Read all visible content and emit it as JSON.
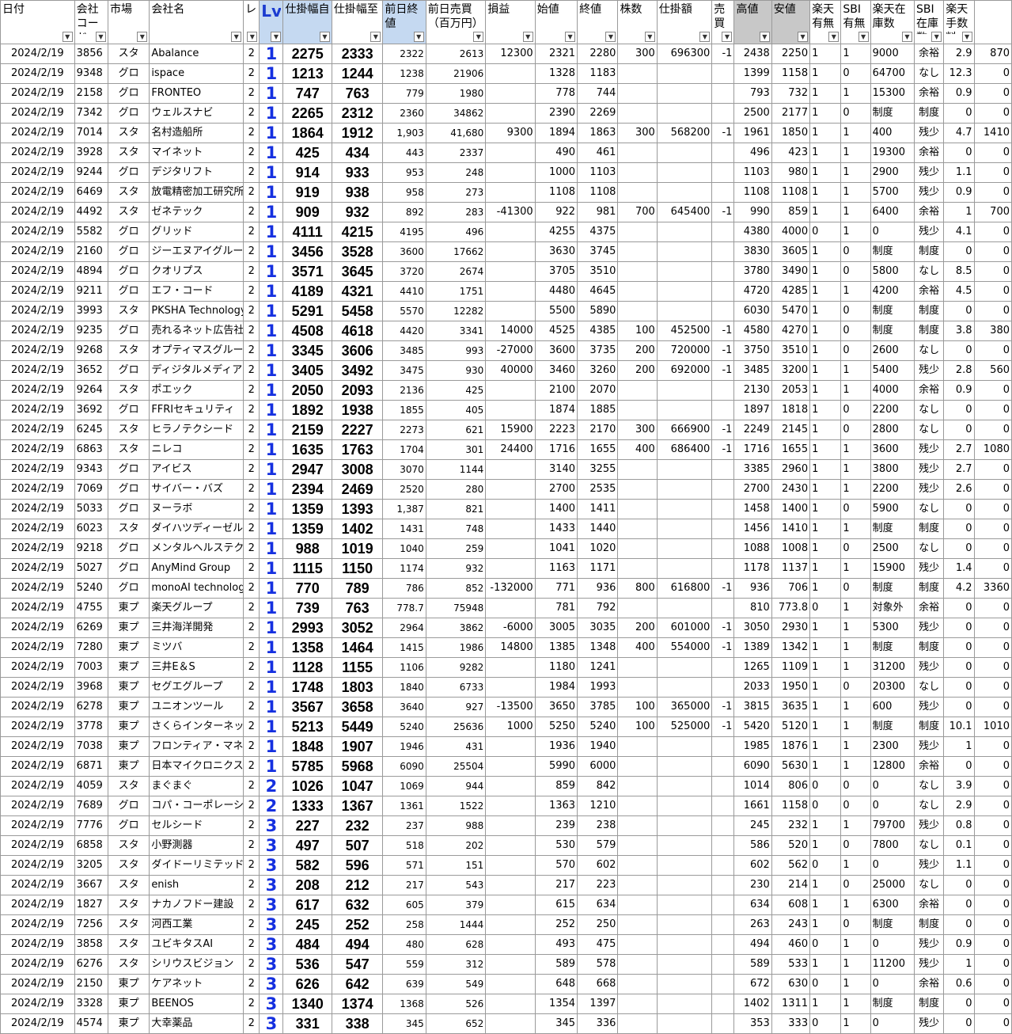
{
  "headers": [
    {
      "label": "日付",
      "style": ""
    },
    {
      "label": "会社コード",
      "style": ""
    },
    {
      "label": "市場",
      "style": ""
    },
    {
      "label": "会社名",
      "style": ""
    },
    {
      "label": "レ",
      "style": ""
    },
    {
      "label": "Lv",
      "style": "lv"
    },
    {
      "label": "仕掛幅自",
      "style": "blue"
    },
    {
      "label": "仕掛幅至",
      "style": ""
    },
    {
      "label": "前日終値",
      "style": "blue"
    },
    {
      "label": "前日売買（百万円）",
      "style": ""
    },
    {
      "label": "損益",
      "style": ""
    },
    {
      "label": "始値",
      "style": ""
    },
    {
      "label": "終値",
      "style": ""
    },
    {
      "label": "株数",
      "style": ""
    },
    {
      "label": "仕掛額",
      "style": ""
    },
    {
      "label": "売買",
      "style": ""
    },
    {
      "label": "高値",
      "style": "gray"
    },
    {
      "label": "安値",
      "style": "gray"
    },
    {
      "label": "楽天有無",
      "style": ""
    },
    {
      "label": "SBI有無",
      "style": ""
    },
    {
      "label": "楽天在庫数",
      "style": ""
    },
    {
      "label": "SBI在庫数",
      "style": ""
    },
    {
      "label": "楽天手数料",
      "style": ""
    },
    {
      "label": "",
      "style": ""
    }
  ],
  "rows": [
    [
      "2024/2/19",
      "3856",
      "スタ",
      "Abalance",
      "2",
      "1",
      "2275",
      "2333",
      "2322",
      "2613",
      "12300",
      "2321",
      "2280",
      "300",
      "696300",
      "-1",
      "2438",
      "2250",
      "1",
      "1",
      "9000",
      "余裕",
      "2.9",
      "870"
    ],
    [
      "2024/2/19",
      "9348",
      "グロ",
      "ispace",
      "2",
      "1",
      "1213",
      "1244",
      "1238",
      "21906",
      "",
      "1328",
      "1183",
      "",
      "",
      "",
      "1399",
      "1158",
      "1",
      "0",
      "64700",
      "なし",
      "12.3",
      "0"
    ],
    [
      "2024/2/19",
      "2158",
      "グロ",
      "FRONTEO",
      "2",
      "1",
      "747",
      "763",
      "779",
      "1980",
      "",
      "778",
      "744",
      "",
      "",
      "",
      "793",
      "732",
      "1",
      "1",
      "15300",
      "余裕",
      "0.9",
      "0"
    ],
    [
      "2024/2/19",
      "7342",
      "グロ",
      "ウェルスナビ",
      "2",
      "1",
      "2265",
      "2312",
      "2360",
      "34862",
      "",
      "2390",
      "2269",
      "",
      "",
      "",
      "2500",
      "2177",
      "1",
      "0",
      "制度",
      "制度",
      "0",
      "0"
    ],
    [
      "2024/2/19",
      "7014",
      "スタ",
      "名村造船所",
      "2",
      "1",
      "1864",
      "1912",
      "1,903",
      "41,680",
      "9300",
      "1894",
      "1863",
      "300",
      "568200",
      "-1",
      "1961",
      "1850",
      "1",
      "1",
      "400",
      "残少",
      "4.7",
      "1410"
    ],
    [
      "2024/2/19",
      "3928",
      "スタ",
      "マイネット",
      "2",
      "1",
      "425",
      "434",
      "443",
      "2337",
      "",
      "490",
      "461",
      "",
      "",
      "",
      "496",
      "423",
      "1",
      "1",
      "19300",
      "余裕",
      "0",
      "0"
    ],
    [
      "2024/2/19",
      "9244",
      "グロ",
      "デジタリフト",
      "2",
      "1",
      "914",
      "933",
      "953",
      "248",
      "",
      "1000",
      "1103",
      "",
      "",
      "",
      "1103",
      "980",
      "1",
      "1",
      "2900",
      "残少",
      "1.1",
      "0"
    ],
    [
      "2024/2/19",
      "6469",
      "スタ",
      "放電精密加工研究所",
      "2",
      "1",
      "919",
      "938",
      "958",
      "273",
      "",
      "1108",
      "1108",
      "",
      "",
      "",
      "1108",
      "1108",
      "1",
      "1",
      "5700",
      "残少",
      "0.9",
      "0"
    ],
    [
      "2024/2/19",
      "4492",
      "スタ",
      "ゼネテック",
      "2",
      "1",
      "909",
      "932",
      "892",
      "283",
      "-41300",
      "922",
      "981",
      "700",
      "645400",
      "-1",
      "990",
      "859",
      "1",
      "1",
      "6400",
      "余裕",
      "1",
      "700"
    ],
    [
      "2024/2/19",
      "5582",
      "グロ",
      "グリッド",
      "2",
      "1",
      "4111",
      "4215",
      "4195",
      "496",
      "",
      "4255",
      "4375",
      "",
      "",
      "",
      "4380",
      "4000",
      "0",
      "1",
      "0",
      "残少",
      "4.1",
      "0"
    ],
    [
      "2024/2/19",
      "2160",
      "グロ",
      "ジーエヌアイグループ",
      "2",
      "1",
      "3456",
      "3528",
      "3600",
      "17662",
      "",
      "3630",
      "3745",
      "",
      "",
      "",
      "3830",
      "3605",
      "1",
      "0",
      "制度",
      "制度",
      "0",
      "0"
    ],
    [
      "2024/2/19",
      "4894",
      "グロ",
      "クオリプス",
      "2",
      "1",
      "3571",
      "3645",
      "3720",
      "2674",
      "",
      "3705",
      "3510",
      "",
      "",
      "",
      "3780",
      "3490",
      "1",
      "0",
      "5800",
      "なし",
      "8.5",
      "0"
    ],
    [
      "2024/2/19",
      "9211",
      "グロ",
      "エフ・コード",
      "2",
      "1",
      "4189",
      "4321",
      "4410",
      "1751",
      "",
      "4480",
      "4645",
      "",
      "",
      "",
      "4720",
      "4285",
      "1",
      "1",
      "4200",
      "余裕",
      "4.5",
      "0"
    ],
    [
      "2024/2/19",
      "3993",
      "スタ",
      "PKSHA Technology",
      "2",
      "1",
      "5291",
      "5458",
      "5570",
      "12282",
      "",
      "5500",
      "5890",
      "",
      "",
      "",
      "6030",
      "5470",
      "1",
      "0",
      "制度",
      "制度",
      "0",
      "0"
    ],
    [
      "2024/2/19",
      "9235",
      "グロ",
      "売れるネット広告社",
      "2",
      "1",
      "4508",
      "4618",
      "4420",
      "3341",
      "14000",
      "4525",
      "4385",
      "100",
      "452500",
      "-1",
      "4580",
      "4270",
      "1",
      "0",
      "制度",
      "制度",
      "3.8",
      "380"
    ],
    [
      "2024/2/19",
      "9268",
      "スタ",
      "オプティマスグループ",
      "2",
      "1",
      "3345",
      "3606",
      "3485",
      "993",
      "-27000",
      "3600",
      "3735",
      "200",
      "720000",
      "-1",
      "3750",
      "3510",
      "1",
      "0",
      "2600",
      "なし",
      "0",
      "0"
    ],
    [
      "2024/2/19",
      "3652",
      "グロ",
      "ディジタルメディアプロフェッショナル",
      "2",
      "1",
      "3405",
      "3492",
      "3475",
      "930",
      "40000",
      "3460",
      "3260",
      "200",
      "692000",
      "-1",
      "3485",
      "3200",
      "1",
      "1",
      "5400",
      "残少",
      "2.8",
      "560"
    ],
    [
      "2024/2/19",
      "9264",
      "スタ",
      "ポエック",
      "2",
      "1",
      "2050",
      "2093",
      "2136",
      "425",
      "",
      "2100",
      "2070",
      "",
      "",
      "",
      "2130",
      "2053",
      "1",
      "1",
      "4000",
      "余裕",
      "0.9",
      "0"
    ],
    [
      "2024/2/19",
      "3692",
      "グロ",
      "FFRIセキュリティ",
      "2",
      "1",
      "1892",
      "1938",
      "1855",
      "405",
      "",
      "1874",
      "1885",
      "",
      "",
      "",
      "1897",
      "1818",
      "1",
      "0",
      "2200",
      "なし",
      "0",
      "0"
    ],
    [
      "2024/2/19",
      "6245",
      "スタ",
      "ヒラノテクシード",
      "2",
      "1",
      "2159",
      "2227",
      "2273",
      "621",
      "15900",
      "2223",
      "2170",
      "300",
      "666900",
      "-1",
      "2249",
      "2145",
      "1",
      "0",
      "2800",
      "なし",
      "0",
      "0"
    ],
    [
      "2024/2/19",
      "6863",
      "スタ",
      "ニレコ",
      "2",
      "1",
      "1635",
      "1763",
      "1704",
      "301",
      "24400",
      "1716",
      "1655",
      "400",
      "686400",
      "-1",
      "1716",
      "1655",
      "1",
      "1",
      "3600",
      "残少",
      "2.7",
      "1080"
    ],
    [
      "2024/2/19",
      "9343",
      "グロ",
      "アイビス",
      "2",
      "1",
      "2947",
      "3008",
      "3070",
      "1144",
      "",
      "3140",
      "3255",
      "",
      "",
      "",
      "3385",
      "2960",
      "1",
      "1",
      "3800",
      "残少",
      "2.7",
      "0"
    ],
    [
      "2024/2/19",
      "7069",
      "グロ",
      "サイバー・バズ",
      "2",
      "1",
      "2394",
      "2469",
      "2520",
      "280",
      "",
      "2700",
      "2535",
      "",
      "",
      "",
      "2700",
      "2430",
      "1",
      "1",
      "2200",
      "残少",
      "2.6",
      "0"
    ],
    [
      "2024/2/19",
      "5033",
      "グロ",
      "ヌーラボ",
      "2",
      "1",
      "1359",
      "1393",
      "1,387",
      "821",
      "",
      "1400",
      "1411",
      "",
      "",
      "",
      "1458",
      "1400",
      "1",
      "0",
      "5900",
      "なし",
      "0",
      "0"
    ],
    [
      "2024/2/19",
      "6023",
      "スタ",
      "ダイハツディーゼル",
      "2",
      "1",
      "1359",
      "1402",
      "1431",
      "748",
      "",
      "1433",
      "1440",
      "",
      "",
      "",
      "1456",
      "1410",
      "1",
      "1",
      "制度",
      "制度",
      "0",
      "0"
    ],
    [
      "2024/2/19",
      "9218",
      "グロ",
      "メンタルヘルステクノロジーズ",
      "2",
      "1",
      "988",
      "1019",
      "1040",
      "259",
      "",
      "1041",
      "1020",
      "",
      "",
      "",
      "1088",
      "1008",
      "1",
      "0",
      "2500",
      "なし",
      "0",
      "0"
    ],
    [
      "2024/2/19",
      "5027",
      "グロ",
      "AnyMind Group",
      "2",
      "1",
      "1115",
      "1150",
      "1174",
      "932",
      "",
      "1163",
      "1171",
      "",
      "",
      "",
      "1178",
      "1137",
      "1",
      "1",
      "15900",
      "残少",
      "1.4",
      "0"
    ],
    [
      "2024/2/19",
      "5240",
      "グロ",
      "monoAI technology",
      "2",
      "1",
      "770",
      "789",
      "786",
      "852",
      "-132000",
      "771",
      "936",
      "800",
      "616800",
      "-1",
      "936",
      "706",
      "1",
      "0",
      "制度",
      "制度",
      "4.2",
      "3360"
    ],
    [
      "2024/2/19",
      "4755",
      "東プ",
      "楽天グループ",
      "2",
      "1",
      "739",
      "763",
      "778.7",
      "75948",
      "",
      "781",
      "792",
      "",
      "",
      "",
      "810",
      "773.8",
      "0",
      "1",
      "対象外",
      "余裕",
      "0",
      "0"
    ],
    [
      "2024/2/19",
      "6269",
      "東プ",
      "三井海洋開発",
      "2",
      "1",
      "2993",
      "3052",
      "2964",
      "3862",
      "-6000",
      "3005",
      "3035",
      "200",
      "601000",
      "-1",
      "3050",
      "2930",
      "1",
      "1",
      "5300",
      "残少",
      "0",
      "0"
    ],
    [
      "2024/2/19",
      "7280",
      "東プ",
      "ミツバ",
      "2",
      "1",
      "1358",
      "1464",
      "1415",
      "1986",
      "14800",
      "1385",
      "1348",
      "400",
      "554000",
      "-1",
      "1389",
      "1342",
      "1",
      "1",
      "制度",
      "制度",
      "0",
      "0"
    ],
    [
      "2024/2/19",
      "7003",
      "東プ",
      "三井E＆S",
      "2",
      "1",
      "1128",
      "1155",
      "1106",
      "9282",
      "",
      "1180",
      "1241",
      "",
      "",
      "",
      "1265",
      "1109",
      "1",
      "1",
      "31200",
      "残少",
      "0",
      "0"
    ],
    [
      "2024/2/19",
      "3968",
      "東プ",
      "セグエグループ",
      "2",
      "1",
      "1748",
      "1803",
      "1840",
      "6733",
      "",
      "1984",
      "1993",
      "",
      "",
      "",
      "2033",
      "1950",
      "1",
      "0",
      "20300",
      "なし",
      "0",
      "0"
    ],
    [
      "2024/2/19",
      "6278",
      "東プ",
      "ユニオンツール",
      "2",
      "1",
      "3567",
      "3658",
      "3640",
      "927",
      "-13500",
      "3650",
      "3785",
      "100",
      "365000",
      "-1",
      "3815",
      "3635",
      "1",
      "1",
      "600",
      "残少",
      "0",
      "0"
    ],
    [
      "2024/2/19",
      "3778",
      "東プ",
      "さくらインターネット",
      "2",
      "1",
      "5213",
      "5449",
      "5240",
      "25636",
      "1000",
      "5250",
      "5240",
      "100",
      "525000",
      "-1",
      "5420",
      "5120",
      "1",
      "1",
      "制度",
      "制度",
      "10.1",
      "1010"
    ],
    [
      "2024/2/19",
      "7038",
      "東プ",
      "フロンティア・マネジメント",
      "2",
      "1",
      "1848",
      "1907",
      "1946",
      "431",
      "",
      "1936",
      "1940",
      "",
      "",
      "",
      "1985",
      "1876",
      "1",
      "1",
      "2300",
      "残少",
      "1",
      "0"
    ],
    [
      "2024/2/19",
      "6871",
      "東プ",
      "日本マイクロニクス",
      "2",
      "1",
      "5785",
      "5968",
      "6090",
      "25504",
      "",
      "5990",
      "6000",
      "",
      "",
      "",
      "6090",
      "5630",
      "1",
      "1",
      "12800",
      "余裕",
      "0",
      "0"
    ],
    [
      "2024/2/19",
      "4059",
      "スタ",
      "まぐまぐ",
      "2",
      "2",
      "1026",
      "1047",
      "1069",
      "944",
      "",
      "859",
      "842",
      "",
      "",
      "",
      "1014",
      "806",
      "0",
      "0",
      "0",
      "なし",
      "3.9",
      "0"
    ],
    [
      "2024/2/19",
      "7689",
      "グロ",
      "コパ・コーポレーション",
      "2",
      "2",
      "1333",
      "1367",
      "1361",
      "1522",
      "",
      "1363",
      "1210",
      "",
      "",
      "",
      "1661",
      "1158",
      "0",
      "0",
      "0",
      "なし",
      "2.9",
      "0"
    ],
    [
      "2024/2/19",
      "7776",
      "グロ",
      "セルシード",
      "2",
      "3",
      "227",
      "232",
      "237",
      "988",
      "",
      "239",
      "238",
      "",
      "",
      "",
      "245",
      "232",
      "1",
      "1",
      "79700",
      "残少",
      "0.8",
      "0"
    ],
    [
      "2024/2/19",
      "6858",
      "スタ",
      "小野測器",
      "2",
      "3",
      "497",
      "507",
      "518",
      "202",
      "",
      "530",
      "579",
      "",
      "",
      "",
      "586",
      "520",
      "1",
      "0",
      "7800",
      "なし",
      "0.1",
      "0"
    ],
    [
      "2024/2/19",
      "3205",
      "スタ",
      "ダイドーリミテッド",
      "2",
      "3",
      "582",
      "596",
      "571",
      "151",
      "",
      "570",
      "602",
      "",
      "",
      "",
      "602",
      "562",
      "0",
      "1",
      "0",
      "残少",
      "1.1",
      "0"
    ],
    [
      "2024/2/19",
      "3667",
      "スタ",
      "enish",
      "2",
      "3",
      "208",
      "212",
      "217",
      "543",
      "",
      "217",
      "223",
      "",
      "",
      "",
      "230",
      "214",
      "1",
      "0",
      "25000",
      "なし",
      "0",
      "0"
    ],
    [
      "2024/2/19",
      "1827",
      "スタ",
      "ナカノフドー建設",
      "2",
      "3",
      "617",
      "632",
      "605",
      "379",
      "",
      "615",
      "634",
      "",
      "",
      "",
      "634",
      "608",
      "1",
      "1",
      "6300",
      "余裕",
      "0",
      "0"
    ],
    [
      "2024/2/19",
      "7256",
      "スタ",
      "河西工業",
      "2",
      "3",
      "245",
      "252",
      "258",
      "1444",
      "",
      "252",
      "250",
      "",
      "",
      "",
      "263",
      "243",
      "1",
      "0",
      "制度",
      "制度",
      "0",
      "0"
    ],
    [
      "2024/2/19",
      "3858",
      "スタ",
      "ユビキタスAI",
      "2",
      "3",
      "484",
      "494",
      "480",
      "628",
      "",
      "493",
      "475",
      "",
      "",
      "",
      "494",
      "460",
      "0",
      "1",
      "0",
      "残少",
      "0.9",
      "0"
    ],
    [
      "2024/2/19",
      "6276",
      "スタ",
      "シリウスビジョン",
      "2",
      "3",
      "536",
      "547",
      "559",
      "312",
      "",
      "589",
      "578",
      "",
      "",
      "",
      "589",
      "533",
      "1",
      "1",
      "11200",
      "残少",
      "1",
      "0"
    ],
    [
      "2024/2/19",
      "2150",
      "東プ",
      "ケアネット",
      "2",
      "3",
      "626",
      "642",
      "639",
      "549",
      "",
      "648",
      "668",
      "",
      "",
      "",
      "672",
      "630",
      "0",
      "1",
      "0",
      "余裕",
      "0.6",
      "0"
    ],
    [
      "2024/2/19",
      "3328",
      "東プ",
      "BEENOS",
      "2",
      "3",
      "1340",
      "1374",
      "1368",
      "526",
      "",
      "1354",
      "1397",
      "",
      "",
      "",
      "1402",
      "1311",
      "1",
      "1",
      "制度",
      "制度",
      "0",
      "0"
    ],
    [
      "2024/2/19",
      "4574",
      "東プ",
      "大幸薬品",
      "2",
      "3",
      "331",
      "338",
      "345",
      "652",
      "",
      "345",
      "336",
      "",
      "",
      "",
      "353",
      "333",
      "0",
      "1",
      "0",
      "残少",
      "0",
      "0"
    ]
  ]
}
